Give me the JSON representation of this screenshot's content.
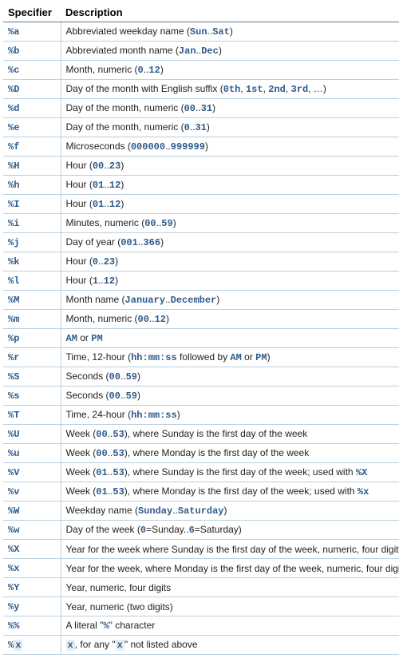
{
  "headers": {
    "specifier": "Specifier",
    "description": "Description"
  },
  "rows": [
    {
      "spec": "%a",
      "parts": [
        {
          "t": "Abbreviated weekday name ("
        },
        {
          "t": "Sun",
          "c": "lit"
        },
        {
          "t": ".."
        },
        {
          "t": "Sat",
          "c": "lit"
        },
        {
          "t": ")"
        }
      ]
    },
    {
      "spec": "%b",
      "parts": [
        {
          "t": "Abbreviated month name ("
        },
        {
          "t": "Jan",
          "c": "lit"
        },
        {
          "t": ".."
        },
        {
          "t": "Dec",
          "c": "lit"
        },
        {
          "t": ")"
        }
      ]
    },
    {
      "spec": "%c",
      "parts": [
        {
          "t": "Month, numeric ("
        },
        {
          "t": "0",
          "c": "lit"
        },
        {
          "t": ".."
        },
        {
          "t": "12",
          "c": "lit"
        },
        {
          "t": ")"
        }
      ]
    },
    {
      "spec": "%D",
      "parts": [
        {
          "t": "Day of the month with English suffix ("
        },
        {
          "t": "0th",
          "c": "lit"
        },
        {
          "t": ", "
        },
        {
          "t": "1st",
          "c": "lit"
        },
        {
          "t": ", "
        },
        {
          "t": "2nd",
          "c": "lit"
        },
        {
          "t": ", "
        },
        {
          "t": "3rd",
          "c": "lit"
        },
        {
          "t": ", …)"
        }
      ]
    },
    {
      "spec": "%d",
      "parts": [
        {
          "t": "Day of the month, numeric ("
        },
        {
          "t": "00",
          "c": "lit"
        },
        {
          "t": ".."
        },
        {
          "t": "31",
          "c": "lit"
        },
        {
          "t": ")"
        }
      ]
    },
    {
      "spec": "%e",
      "parts": [
        {
          "t": "Day of the month, numeric ("
        },
        {
          "t": "0",
          "c": "lit"
        },
        {
          "t": ".."
        },
        {
          "t": "31",
          "c": "lit"
        },
        {
          "t": ")"
        }
      ]
    },
    {
      "spec": "%f",
      "parts": [
        {
          "t": "Microseconds ("
        },
        {
          "t": "000000",
          "c": "lit"
        },
        {
          "t": ".."
        },
        {
          "t": "999999",
          "c": "lit"
        },
        {
          "t": ")"
        }
      ]
    },
    {
      "spec": "%H",
      "parts": [
        {
          "t": "Hour ("
        },
        {
          "t": "00",
          "c": "lit"
        },
        {
          "t": ".."
        },
        {
          "t": "23",
          "c": "lit"
        },
        {
          "t": ")"
        }
      ]
    },
    {
      "spec": "%h",
      "parts": [
        {
          "t": "Hour ("
        },
        {
          "t": "01",
          "c": "lit"
        },
        {
          "t": ".."
        },
        {
          "t": "12",
          "c": "lit"
        },
        {
          "t": ")"
        }
      ]
    },
    {
      "spec": "%I",
      "parts": [
        {
          "t": "Hour ("
        },
        {
          "t": "01",
          "c": "lit"
        },
        {
          "t": ".."
        },
        {
          "t": "12",
          "c": "lit"
        },
        {
          "t": ")"
        }
      ]
    },
    {
      "spec": "%i",
      "parts": [
        {
          "t": "Minutes, numeric ("
        },
        {
          "t": "00",
          "c": "lit"
        },
        {
          "t": ".."
        },
        {
          "t": "59",
          "c": "lit"
        },
        {
          "t": ")"
        }
      ]
    },
    {
      "spec": "%j",
      "parts": [
        {
          "t": "Day of year ("
        },
        {
          "t": "001",
          "c": "lit"
        },
        {
          "t": ".."
        },
        {
          "t": "366",
          "c": "lit"
        },
        {
          "t": ")"
        }
      ]
    },
    {
      "spec": "%k",
      "parts": [
        {
          "t": "Hour ("
        },
        {
          "t": "0",
          "c": "lit"
        },
        {
          "t": ".."
        },
        {
          "t": "23",
          "c": "lit"
        },
        {
          "t": ")"
        }
      ]
    },
    {
      "spec": "%l",
      "parts": [
        {
          "t": "Hour ("
        },
        {
          "t": "1",
          "c": "lit"
        },
        {
          "t": ".."
        },
        {
          "t": "12",
          "c": "lit"
        },
        {
          "t": ")"
        }
      ]
    },
    {
      "spec": "%M",
      "parts": [
        {
          "t": "Month name ("
        },
        {
          "t": "January",
          "c": "lit"
        },
        {
          "t": ".."
        },
        {
          "t": "December",
          "c": "lit"
        },
        {
          "t": ")"
        }
      ]
    },
    {
      "spec": "%m",
      "parts": [
        {
          "t": "Month, numeric ("
        },
        {
          "t": "00",
          "c": "lit"
        },
        {
          "t": ".."
        },
        {
          "t": "12",
          "c": "lit"
        },
        {
          "t": ")"
        }
      ]
    },
    {
      "spec": "%p",
      "parts": [
        {
          "t": "AM",
          "c": "lit"
        },
        {
          "t": " or "
        },
        {
          "t": "PM",
          "c": "lit"
        }
      ]
    },
    {
      "spec": "%r",
      "parts": [
        {
          "t": "Time, 12-hour ("
        },
        {
          "t": "hh:mm:ss",
          "c": "lit"
        },
        {
          "t": " followed by "
        },
        {
          "t": "AM",
          "c": "lit"
        },
        {
          "t": " or "
        },
        {
          "t": "PM",
          "c": "lit"
        },
        {
          "t": ")"
        }
      ]
    },
    {
      "spec": "%S",
      "parts": [
        {
          "t": "Seconds ("
        },
        {
          "t": "00",
          "c": "lit"
        },
        {
          "t": ".."
        },
        {
          "t": "59",
          "c": "lit"
        },
        {
          "t": ")"
        }
      ]
    },
    {
      "spec": "%s",
      "parts": [
        {
          "t": "Seconds ("
        },
        {
          "t": "00",
          "c": "lit"
        },
        {
          "t": ".."
        },
        {
          "t": "59",
          "c": "lit"
        },
        {
          "t": ")"
        }
      ]
    },
    {
      "spec": "%T",
      "parts": [
        {
          "t": "Time, 24-hour ("
        },
        {
          "t": "hh:mm:ss",
          "c": "lit"
        },
        {
          "t": ")"
        }
      ]
    },
    {
      "spec": "%U",
      "parts": [
        {
          "t": "Week ("
        },
        {
          "t": "00",
          "c": "lit"
        },
        {
          "t": ".."
        },
        {
          "t": "53",
          "c": "lit"
        },
        {
          "t": "), where Sunday is the first day of the week"
        }
      ]
    },
    {
      "spec": "%u",
      "parts": [
        {
          "t": "Week ("
        },
        {
          "t": "00",
          "c": "lit"
        },
        {
          "t": ".."
        },
        {
          "t": "53",
          "c": "lit"
        },
        {
          "t": "), where Monday is the first day of the week"
        }
      ]
    },
    {
      "spec": "%V",
      "parts": [
        {
          "t": "Week ("
        },
        {
          "t": "01",
          "c": "lit"
        },
        {
          "t": ".."
        },
        {
          "t": "53",
          "c": "lit"
        },
        {
          "t": "), where Sunday is the first day of the week; used with "
        },
        {
          "t": "%X",
          "c": "lit"
        }
      ]
    },
    {
      "spec": "%v",
      "parts": [
        {
          "t": "Week ("
        },
        {
          "t": "01",
          "c": "lit"
        },
        {
          "t": ".."
        },
        {
          "t": "53",
          "c": "lit"
        },
        {
          "t": "), where Monday is the first day of the week; used with "
        },
        {
          "t": "%x",
          "c": "lit"
        }
      ]
    },
    {
      "spec": "%W",
      "parts": [
        {
          "t": "Weekday name ("
        },
        {
          "t": "Sunday",
          "c": "lit"
        },
        {
          "t": ".."
        },
        {
          "t": "Saturday",
          "c": "lit"
        },
        {
          "t": ")"
        }
      ]
    },
    {
      "spec": "%w",
      "parts": [
        {
          "t": "Day of the week ("
        },
        {
          "t": "0",
          "c": "lit"
        },
        {
          "t": "=Sunday.."
        },
        {
          "t": "6",
          "c": "lit"
        },
        {
          "t": "=Saturday)"
        }
      ]
    },
    {
      "spec": "%X",
      "parts": [
        {
          "t": "Year for the week where Sunday is the first day of the week, numeric, four digits"
        }
      ]
    },
    {
      "spec": "%x",
      "parts": [
        {
          "t": "Year for the week, where Monday is the first day of the week, numeric, four digits"
        }
      ]
    },
    {
      "spec": "%Y",
      "parts": [
        {
          "t": "Year, numeric, four digits"
        }
      ]
    },
    {
      "spec": "%y",
      "parts": [
        {
          "t": "Year, numeric (two digits)"
        }
      ]
    },
    {
      "spec": "%%",
      "parts": [
        {
          "t": "A literal \""
        },
        {
          "t": "%",
          "c": "lit"
        },
        {
          "t": "\" character"
        }
      ]
    },
    {
      "spec_parts": [
        {
          "t": "%",
          "c": "lit"
        },
        {
          "t": "x",
          "c": "litbg"
        }
      ],
      "parts": [
        {
          "t": "x",
          "c": "litbg"
        },
        {
          "t": ", for any \""
        },
        {
          "t": "x",
          "c": "litbg"
        },
        {
          "t": "\" not listed above"
        }
      ]
    }
  ]
}
